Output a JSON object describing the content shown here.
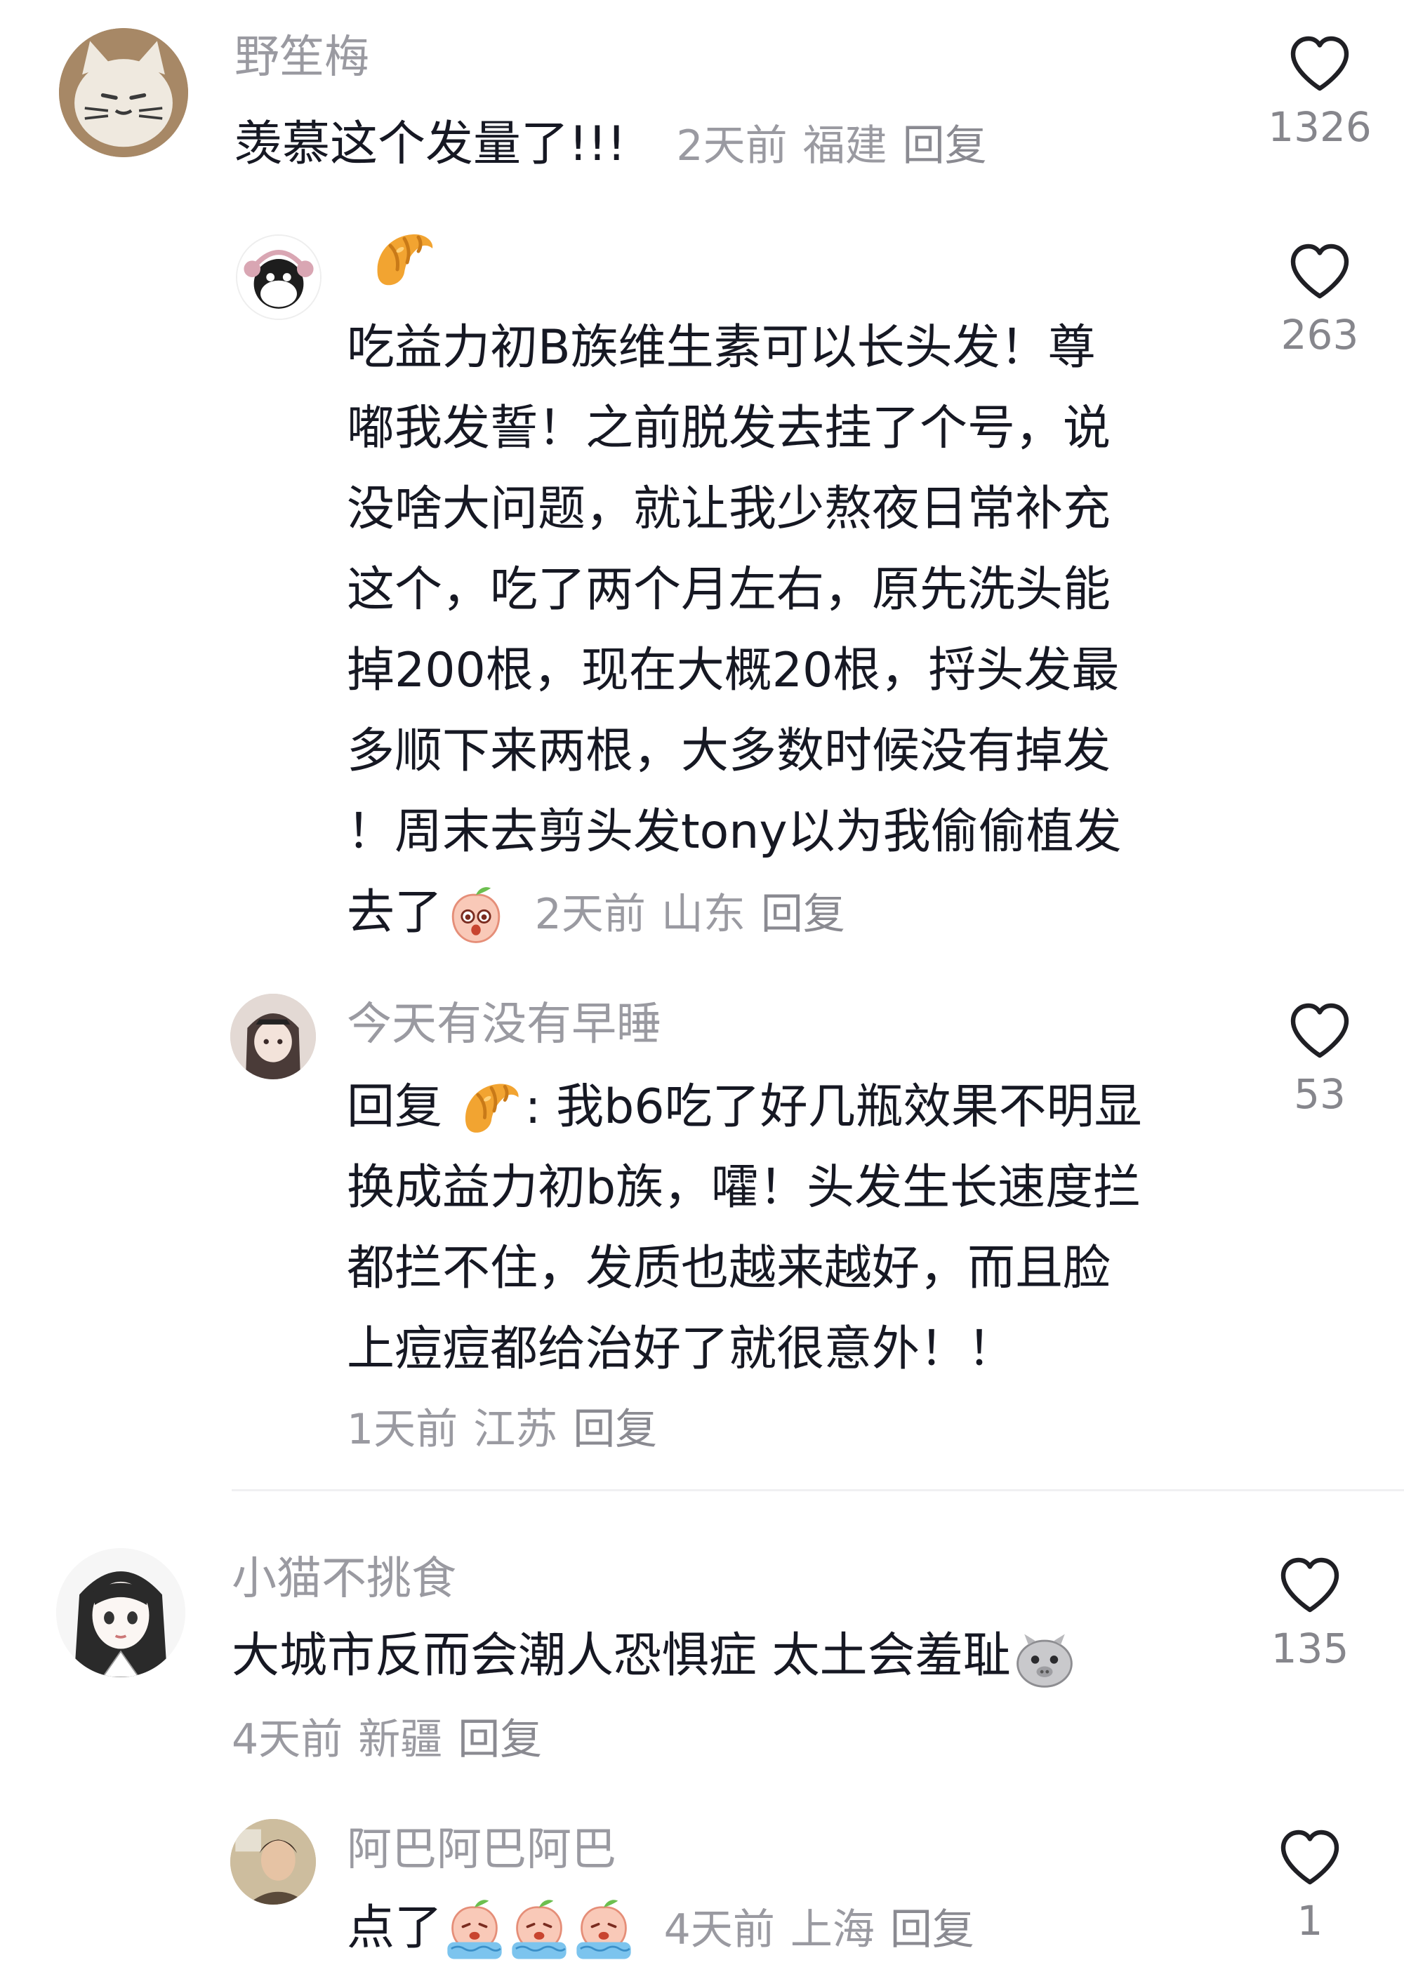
{
  "comments": [
    {
      "user": "野笙梅",
      "text": "羡慕这个发量了!!!",
      "time": "2天前",
      "location": "福建",
      "reply": "回复",
      "likes": "1326",
      "avatar_icon": "cat-avatar-icon",
      "replies": [
        {
          "user_icon": "croissant-emoji-icon",
          "avatar_icon": "cow-avatar-icon",
          "lines": [
            "吃益力初B族维生素可以长头发！尊",
            "嘟我发誓！之前脱发去挂了个号，说",
            "没啥大问题，就让我少熬夜日常补充",
            "这个，吃了两个月左右，原先洗头能",
            "掉200根，现在大概20根，捋头发最",
            "多顺下来两根，大多数时候没有掉发",
            "！周末去剪头发tony以为我偷偷植发"
          ],
          "last_line": "去了",
          "emoji_icon": "peach-surprised-emoji-icon",
          "time": "2天前",
          "location": "山东",
          "reply": "回复",
          "likes": "263"
        },
        {
          "user": "今天有没有早睡",
          "avatar_icon": "girl-avatar-icon",
          "reply_prefix": "回复",
          "reply_to_icon": "croissant-emoji-icon",
          "first_line_rest": ": 我b6吃了好几瓶效果不明显",
          "lines": [
            "换成益力初b族，嚯！头发生长速度拦",
            "都拦不住，发质也越来越好，而且脸",
            "上痘痘都给治好了就很意外！！"
          ],
          "time": "1天前",
          "location": "江苏",
          "reply": "回复",
          "likes": "53"
        }
      ]
    },
    {
      "user": "小猫不挑食",
      "text": "大城市反而会潮人恐惧症 太土会羞耻",
      "emoji_icon": "pig-shy-emoji-icon",
      "time": "4天前",
      "location": "新疆",
      "reply": "回复",
      "likes": "135",
      "avatar_icon": "anime-girl-avatar-icon",
      "replies": [
        {
          "user": "阿巴阿巴阿巴",
          "avatar_icon": "person-avatar-icon",
          "text": "点了",
          "emoji_icons": [
            "peach-crying-emoji-icon",
            "peach-crying-emoji-icon",
            "peach-crying-emoji-icon"
          ],
          "time": "4天前",
          "location": "上海",
          "reply": "回复",
          "likes": "1"
        }
      ]
    }
  ],
  "colors": {
    "text": "#161823",
    "meta": "#9a9aa1",
    "like_icon": "#1f1f24",
    "divider": "#f0f0f2"
  }
}
